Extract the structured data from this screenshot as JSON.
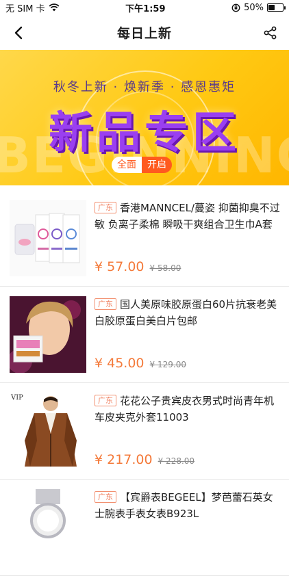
{
  "status_bar": {
    "carrier": "无 SIM 卡",
    "time": "下午1:59",
    "battery_percent": "50%",
    "battery_level": 0.5
  },
  "nav": {
    "title": "每日上新"
  },
  "banner": {
    "slogan": "秋冬上新 · 焕新季 · 感恩惠矩",
    "headline": "新品专区",
    "button_left": "全面",
    "button_right": "开启",
    "watermark": "BEGINNING"
  },
  "products": [
    {
      "tag": "广东",
      "title": "香港MANNCEL/蔓姿 抑菌抑臭不过敏 负离子柔棉 瞬吸干爽组合卫生巾A套餐",
      "price": "¥ 57.00",
      "original_price": "¥ 58.00",
      "image": "sanitary-pad-boxes"
    },
    {
      "tag": "广东",
      "title": "国人美原味胶原蛋白60片抗衰老美白胶原蛋白美白片包邮",
      "price": "¥ 45.00",
      "original_price": "¥ 129.00",
      "image": "collagen-product"
    },
    {
      "tag": "广东",
      "title": "花花公子贵宾皮衣男式时尚青年机车皮夹克外套11003",
      "price": "¥ 217.00",
      "original_price": "¥ 228.00",
      "image": "leather-jacket",
      "brand_mark": "VIP"
    },
    {
      "tag": "广东",
      "title": "【宾爵表BEGEEL】梦芭蕾石英女士腕表手表女表B923L",
      "price": "",
      "original_price": "",
      "image": "wrist-watch"
    }
  ]
}
